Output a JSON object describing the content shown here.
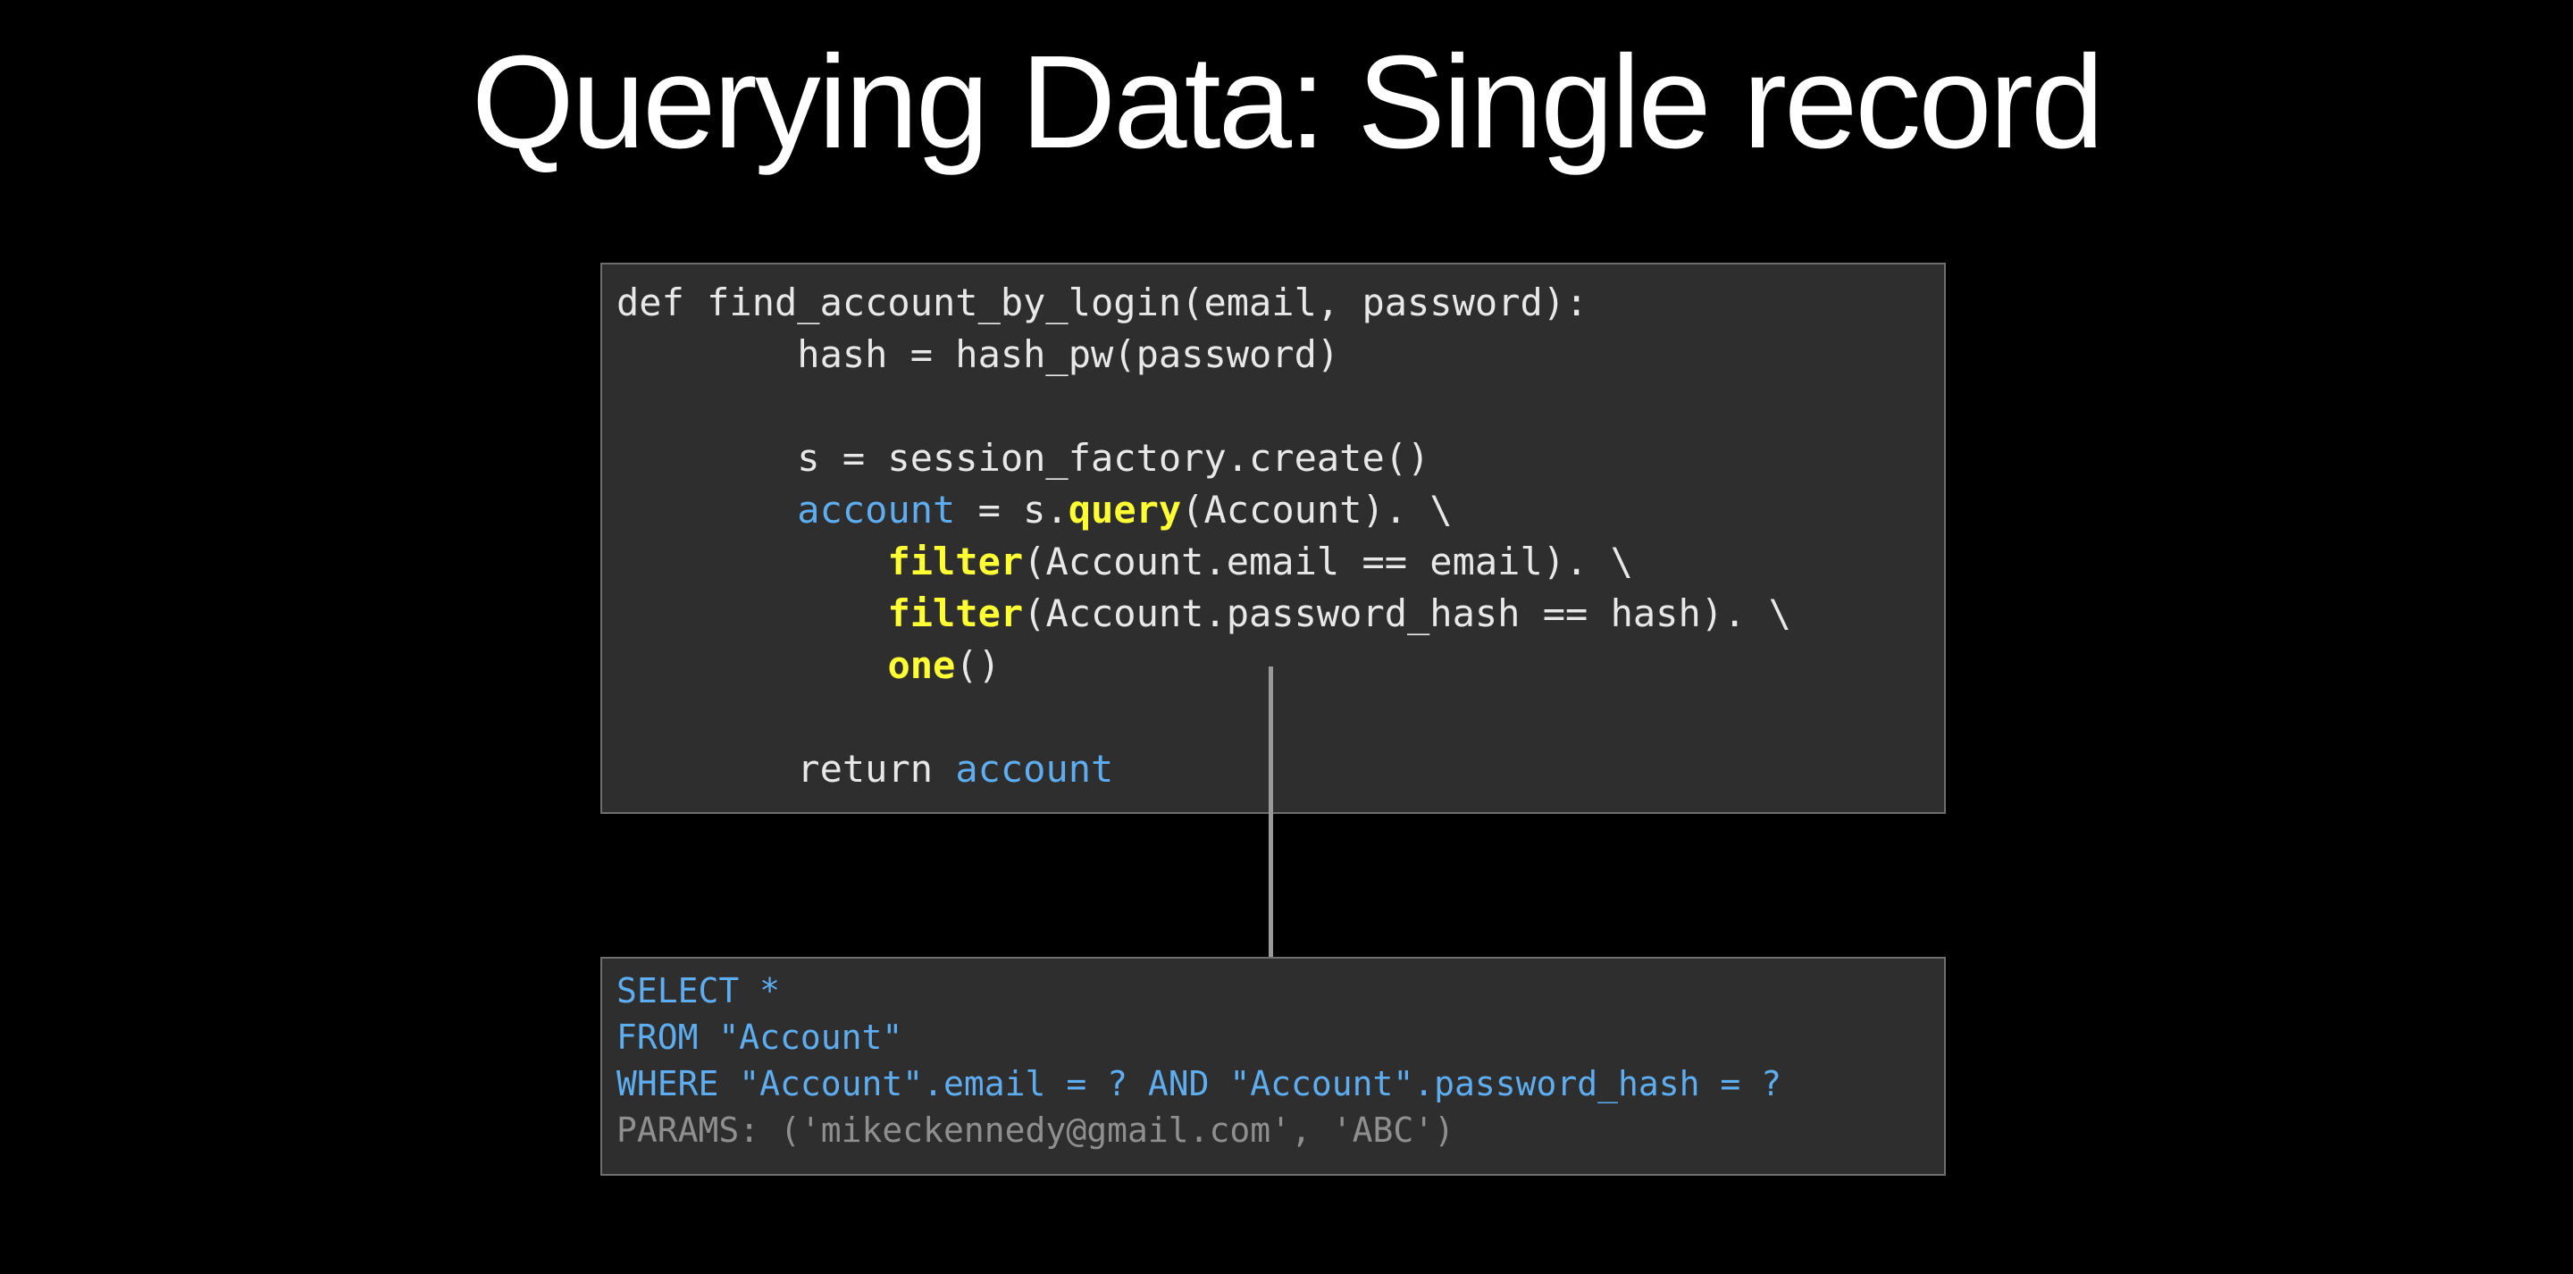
{
  "slide": {
    "title": "Querying Data: Single record"
  },
  "python_code": {
    "line1": "def find_account_by_login(email, password):",
    "line2": "        hash = hash_pw(password)",
    "line4": "        s = session_factory.create()",
    "line5_indent": "        ",
    "line5_var": "account",
    "line5_mid": " = s.",
    "line5_method": "query",
    "line5_rest": "(Account). \\",
    "line6_indent": "            ",
    "line6_method": "filter",
    "line6_rest": "(Account.email == email). \\",
    "line7_indent": "            ",
    "line7_method": "filter",
    "line7_rest": "(Account.password_hash == hash). \\",
    "line8_indent": "            ",
    "line8_method": "one",
    "line8_rest": "()",
    "line10_indent": "        ",
    "line10_kw": "return ",
    "line10_var": "account"
  },
  "sql_output": {
    "line1": "SELECT *",
    "line2": "FROM \"Account\"",
    "line3": "WHERE \"Account\".email = ? AND \"Account\".password_hash = ?",
    "line4": "PARAMS: ('mikeckennedy@gmail.com', 'ABC')"
  },
  "colors": {
    "background": "#000000",
    "code_box": "#2e2e2e",
    "variable": "#5dadf0",
    "highlight_method": "#ffff33",
    "sql": "#5dadf0",
    "params": "#8f8f8f",
    "arrow": "#9a9a9a"
  },
  "icons": {
    "arrow": "down-arrow-icon"
  }
}
